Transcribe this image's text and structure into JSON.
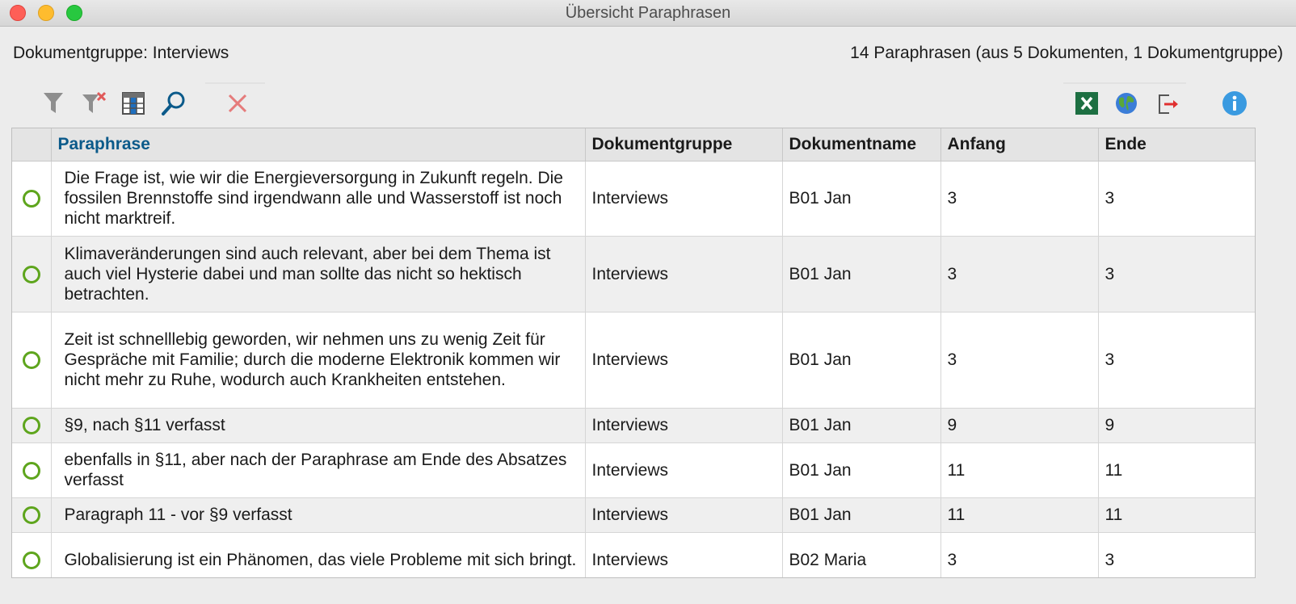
{
  "window": {
    "title": "Übersicht Paraphrasen"
  },
  "info": {
    "group_label": "Dokumentgruppe: Interviews",
    "summary": "14 Paraphrasen (aus 5 Dokumenten, 1 Dokumentgruppe)"
  },
  "toolbar": {
    "left_icons": [
      "filter-icon",
      "remove-filter-icon",
      "column-settings-icon",
      "search-icon",
      "delete-icon"
    ],
    "right_icons": [
      "excel-export-icon",
      "web-export-icon",
      "export-icon",
      "info-icon"
    ]
  },
  "colors": {
    "accent": "#0b5a8a",
    "marker": "#5ea51d",
    "delete": "#e05a5a",
    "excel": "#1d6f42",
    "info": "#3a9ae0"
  },
  "table": {
    "columns": [
      "",
      "Paraphrase",
      "Dokumentgruppe",
      "Dokumentname",
      "Anfang",
      "Ende"
    ],
    "sorted_column": "Paraphrase",
    "rows": [
      {
        "paraphrase": "Die Frage ist, wie wir die Energieversorgung in Zukunft regeln. Die fossilen Brennstoffe sind irgendwann alle und Wasserstoff ist noch nicht marktreif.",
        "group": "Interviews",
        "doc": "B01 Jan",
        "start": "3",
        "end": "3"
      },
      {
        "paraphrase": "Klimaveränderungen sind auch relevant, aber bei dem Thema ist auch viel Hysterie dabei und man sollte das nicht so hektisch betrachten.",
        "group": "Interviews",
        "doc": "B01 Jan",
        "start": "3",
        "end": "3"
      },
      {
        "paraphrase": "Zeit ist schnelllebig geworden, wir nehmen uns zu wenig Zeit für Gespräche mit Familie; durch die moderne Elektronik kommen wir nicht mehr zu Ruhe, wodurch auch Krankheiten entstehen.",
        "group": "Interviews",
        "doc": "B01 Jan",
        "start": "3",
        "end": "3"
      },
      {
        "paraphrase": "§9, nach §11 verfasst",
        "group": "Interviews",
        "doc": "B01 Jan",
        "start": "9",
        "end": "9"
      },
      {
        "paraphrase": "ebenfalls in §11, aber nach der Paraphrase am Ende des Absatzes verfasst",
        "group": "Interviews",
        "doc": "B01 Jan",
        "start": "11",
        "end": "11"
      },
      {
        "paraphrase": "Paragraph 11 - vor §9 verfasst",
        "group": "Interviews",
        "doc": "B01 Jan",
        "start": "11",
        "end": "11"
      },
      {
        "paraphrase": "Globalisierung ist ein Phänomen, das viele Probleme mit sich bringt.",
        "group": "Interviews",
        "doc": "B02 Maria",
        "start": "3",
        "end": "3"
      }
    ]
  }
}
